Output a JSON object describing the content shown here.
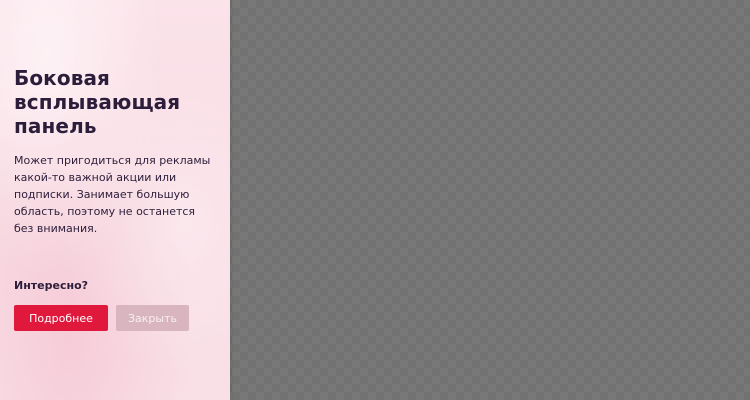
{
  "colors": {
    "overlay": "#727272",
    "panel_bg": "#f8dbe3",
    "text": "#2c1d3a",
    "primary_button": "#e0193c",
    "secondary_button": "#d9b6bf"
  },
  "panel": {
    "title": "Боковая всплывающая панель",
    "description": "Может пригодиться для рекламы какой-то важной акции или подписки. Занимает большую область, поэтому не останется без внимания.",
    "question": "Интересно?",
    "primary_button_label": "Подробнее",
    "secondary_button_label": "Закрыть"
  }
}
